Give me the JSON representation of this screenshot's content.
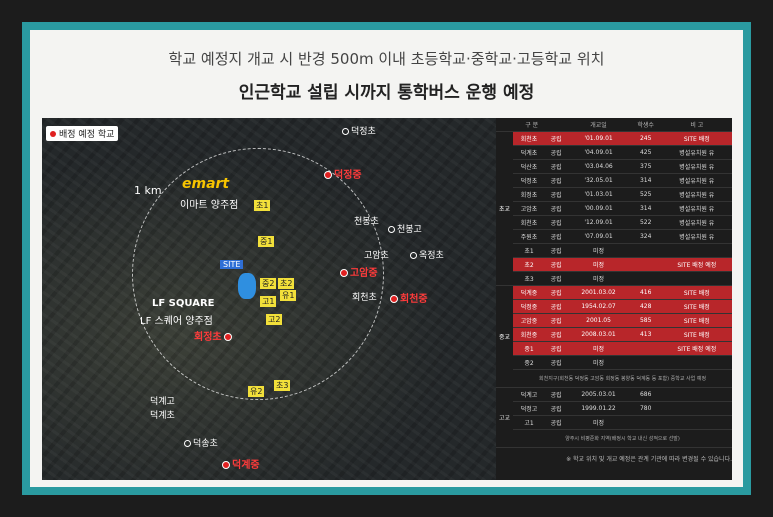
{
  "header": {
    "line1": "학교 예정지 개교 시 반경 500m 이내 초등학교·중학교·고등학교 위치",
    "line2": "인근학교 설립 시까지 통학버스 운행 예정"
  },
  "map": {
    "legend": "배정 예정 학교",
    "radius_label": "1 km",
    "emart_logo": "emart",
    "emart_label": "이마트 양주점",
    "lf_label1": "LF SQUARE",
    "lf_label2": "LF 스퀘어 양주점",
    "site_label": "SITE",
    "schools_red": {
      "deokjeong_mid": "덕정중",
      "goam_mid": "고암중",
      "hoecheon_mid": "회천중",
      "hoejeong_elem": "회정초",
      "deokgye_mid": "덕계중"
    },
    "places_white": {
      "deokjeong_elem": "덕정초",
      "cheonbong_elem": "천봉초",
      "cheonbong_high": "천봉고",
      "goam_elem": "고암초",
      "okjeong_elem": "옥정초",
      "hoecheon_elem": "회천초",
      "deokgye_high": "덕계고",
      "deokgye_elem": "덕계초",
      "deoksong_elem": "덕송초"
    },
    "yellow_tags": {
      "cho1": "초1",
      "jung1": "중1",
      "jung2": "중2",
      "go1": "고1",
      "cho2": "초2",
      "yu1": "유1",
      "cho3": "초3",
      "yu2": "유2",
      "go2": "고2"
    }
  },
  "table": {
    "headers": [
      "구 분",
      "개교일",
      "학생수",
      "비 고"
    ],
    "sections": {
      "elem": "초교",
      "mid": "중교",
      "high": "고교"
    },
    "elem_rows": [
      [
        "회천초",
        "공립",
        "'01.09.01",
        "245",
        "SITE 배정"
      ],
      [
        "덕계초",
        "공립",
        "'04.09.01",
        "425",
        "병설유치원 유"
      ],
      [
        "덕산초",
        "공립",
        "'03.04.06",
        "375",
        "병설유치원 유"
      ],
      [
        "덕정초",
        "공립",
        "'32.05.01",
        "314",
        "병설유치원 유"
      ],
      [
        "회정초",
        "공립",
        "'01.03.01",
        "525",
        "병설유치원 유"
      ],
      [
        "고암초",
        "공립",
        "'00.09.01",
        "314",
        "병설유치원 유"
      ],
      [
        "회천초",
        "공립",
        "'12.09.01",
        "522",
        "병설유치원 유"
      ],
      [
        "주원초",
        "공립",
        "'07.09.01",
        "324",
        "병설유치원 유"
      ],
      [
        "초1",
        "공립",
        "미정",
        "",
        ""
      ],
      [
        "초2",
        "공립",
        "미정",
        "",
        "SITE 배정 예정"
      ],
      [
        "초3",
        "공립",
        "미정",
        "",
        ""
      ]
    ],
    "mid_rows": [
      [
        "덕계중",
        "공립",
        "2001.03.02",
        "416",
        "SITE 배정"
      ],
      [
        "덕정중",
        "공립",
        "1954.02.07",
        "428",
        "SITE 배정"
      ],
      [
        "고암중",
        "공립",
        "2001.05",
        "585",
        "SITE 배정"
      ],
      [
        "회천중",
        "공립",
        "2008.03.01",
        "413",
        "SITE 배정"
      ],
      [
        "중1",
        "공립",
        "미정",
        "",
        "SITE 배정 예정"
      ],
      [
        "중2",
        "공립",
        "미정",
        "",
        ""
      ]
    ],
    "mid_note": "회천지구(회천동 덕정동 고암동 회정동 봉양동 덕계동 등 포함) 중학교 사업 예정",
    "high_rows": [
      [
        "덕계고",
        "공립",
        "2005.03.01",
        "686",
        ""
      ],
      [
        "덕정고",
        "공립",
        "1999.01.22",
        "780",
        ""
      ],
      [
        "고1",
        "공립",
        "미정",
        "",
        ""
      ]
    ],
    "high_note": "양주시 비평준화 지역(배정시 학교 내신 성적으로 선발)",
    "footnote": "※ 학교 위치 및 개교 예정은 관계 기관에 따라 변경될 수 있습니다."
  }
}
